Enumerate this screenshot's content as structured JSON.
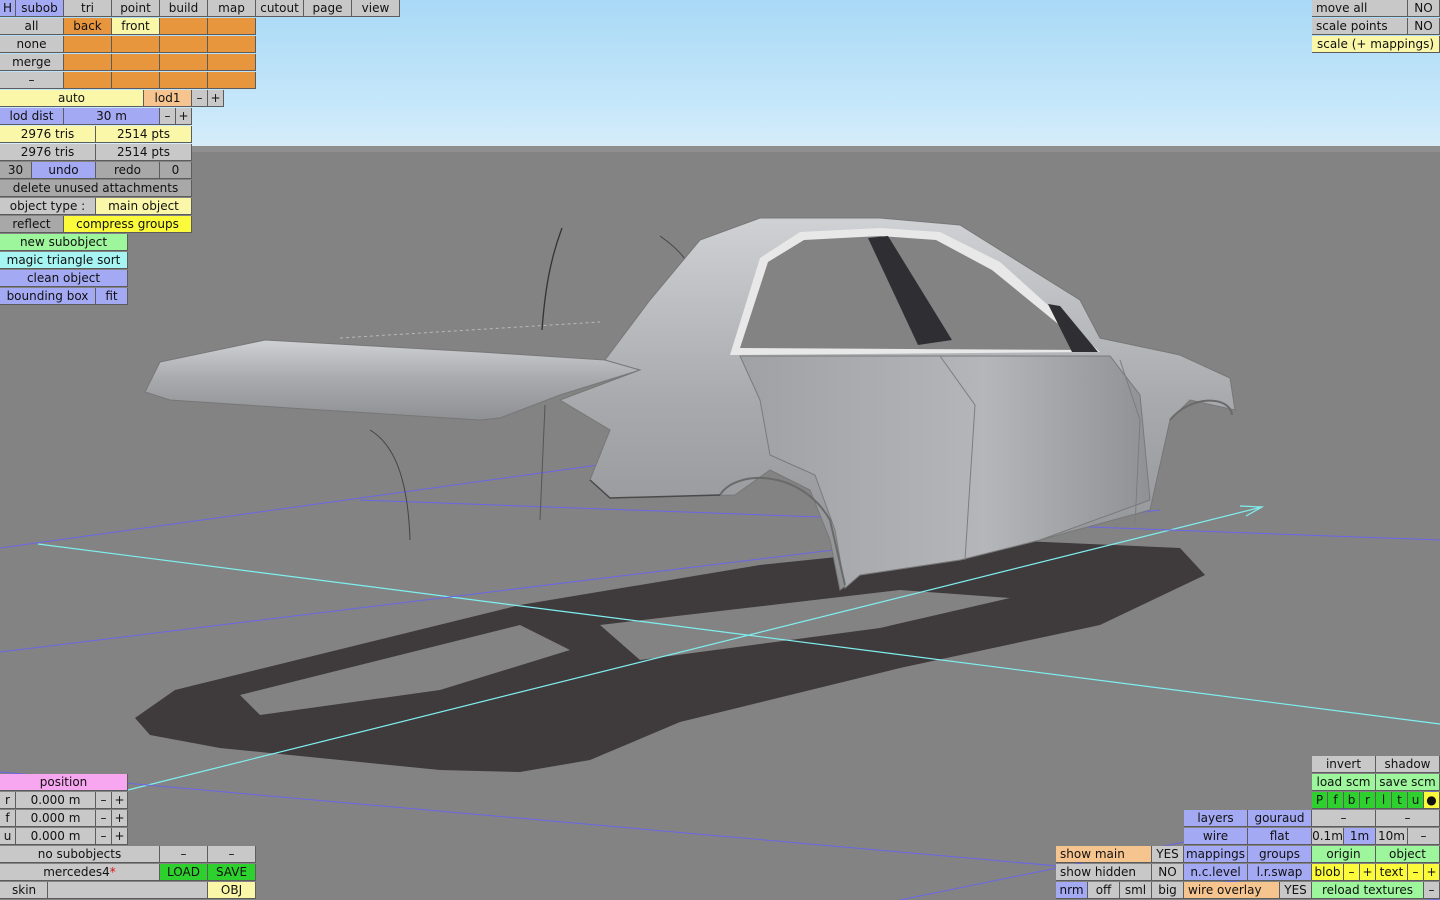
{
  "top_menu": {
    "h": "H",
    "subob": "subob",
    "tri": "tri",
    "point": "point",
    "build": "build",
    "map": "map",
    "cutout": "cutout",
    "page": "page",
    "view": "view"
  },
  "selection": {
    "all": "all",
    "back": "back",
    "front": "front",
    "none": "none",
    "merge": "merge",
    "minus": "–"
  },
  "lod": {
    "auto": "auto",
    "lod1": "lod1",
    "minus": "–",
    "plus": "+",
    "lod_dist_label": "lod dist",
    "lod_dist_value": "30 m"
  },
  "stats": {
    "tris1": "2976 tris",
    "pts1": "2514 pts",
    "tris2": "2976 tris",
    "pts2": "2514 pts"
  },
  "history": {
    "count": "30",
    "undo": "undo",
    "redo": "redo",
    "redo_count": "0"
  },
  "actions": {
    "delete_unused": "delete unused attachments",
    "object_type_label": "object type :",
    "object_type_value": "main object",
    "reflect": "reflect",
    "compress_groups": "compress groups",
    "new_subobject": "new subobject",
    "magic_sort": "magic triangle sort",
    "clean_object": "clean object",
    "bounding_box": "bounding box",
    "fit": "fit"
  },
  "top_right": {
    "move_all": "move all",
    "move_all_val": "NO",
    "scale_points": "scale points",
    "scale_points_val": "NO",
    "scale_mappings": "scale (+ mappings)"
  },
  "position": {
    "title": "position",
    "rows": [
      {
        "axis": "r",
        "value": "0.000 m"
      },
      {
        "axis": "f",
        "value": "0.000 m"
      },
      {
        "axis": "u",
        "value": "0.000 m"
      }
    ],
    "minus": "–",
    "plus": "+"
  },
  "bottom_left": {
    "no_subobjects": "no subobjects",
    "dash": "–",
    "filename": "mercedes4",
    "modified_mark": "*",
    "load": "LOAD",
    "save": "SAVE",
    "skin": "skin",
    "obj": "OBJ"
  },
  "bottom_right": {
    "invert": "invert",
    "shadow": "shadow",
    "load_scm": "load scm",
    "save_scm": "save scm",
    "views": [
      "P",
      "f",
      "b",
      "r",
      "l",
      "t",
      "u",
      "●"
    ],
    "dash": "–",
    "layers": "layers",
    "gouraud": "gouraud",
    "wire": "wire",
    "flat": "flat",
    "step_01": "0.1m",
    "step_1": "1m",
    "step_10": "10m",
    "mappings": "mappings",
    "groups": "groups",
    "origin": "origin",
    "object": "object",
    "show_main": "show main",
    "show_main_val": "YES",
    "n_c_level": "n.c.level",
    "l_r_swap": "l.r.swap",
    "blob": "blob",
    "minus": "–",
    "plus": "+",
    "text": "text",
    "show_hidden": "show hidden",
    "show_hidden_val": "NO",
    "nrm": "nrm",
    "off": "off",
    "sml": "sml",
    "big": "big",
    "wire_overlay": "wire overlay",
    "wire_overlay_val": "YES",
    "reload_textures": "reload textures"
  },
  "colors": {
    "sky": "#b9e0f8",
    "ground": "#838383",
    "body": "#a8aaad",
    "shadow": "#3f3a3c"
  }
}
